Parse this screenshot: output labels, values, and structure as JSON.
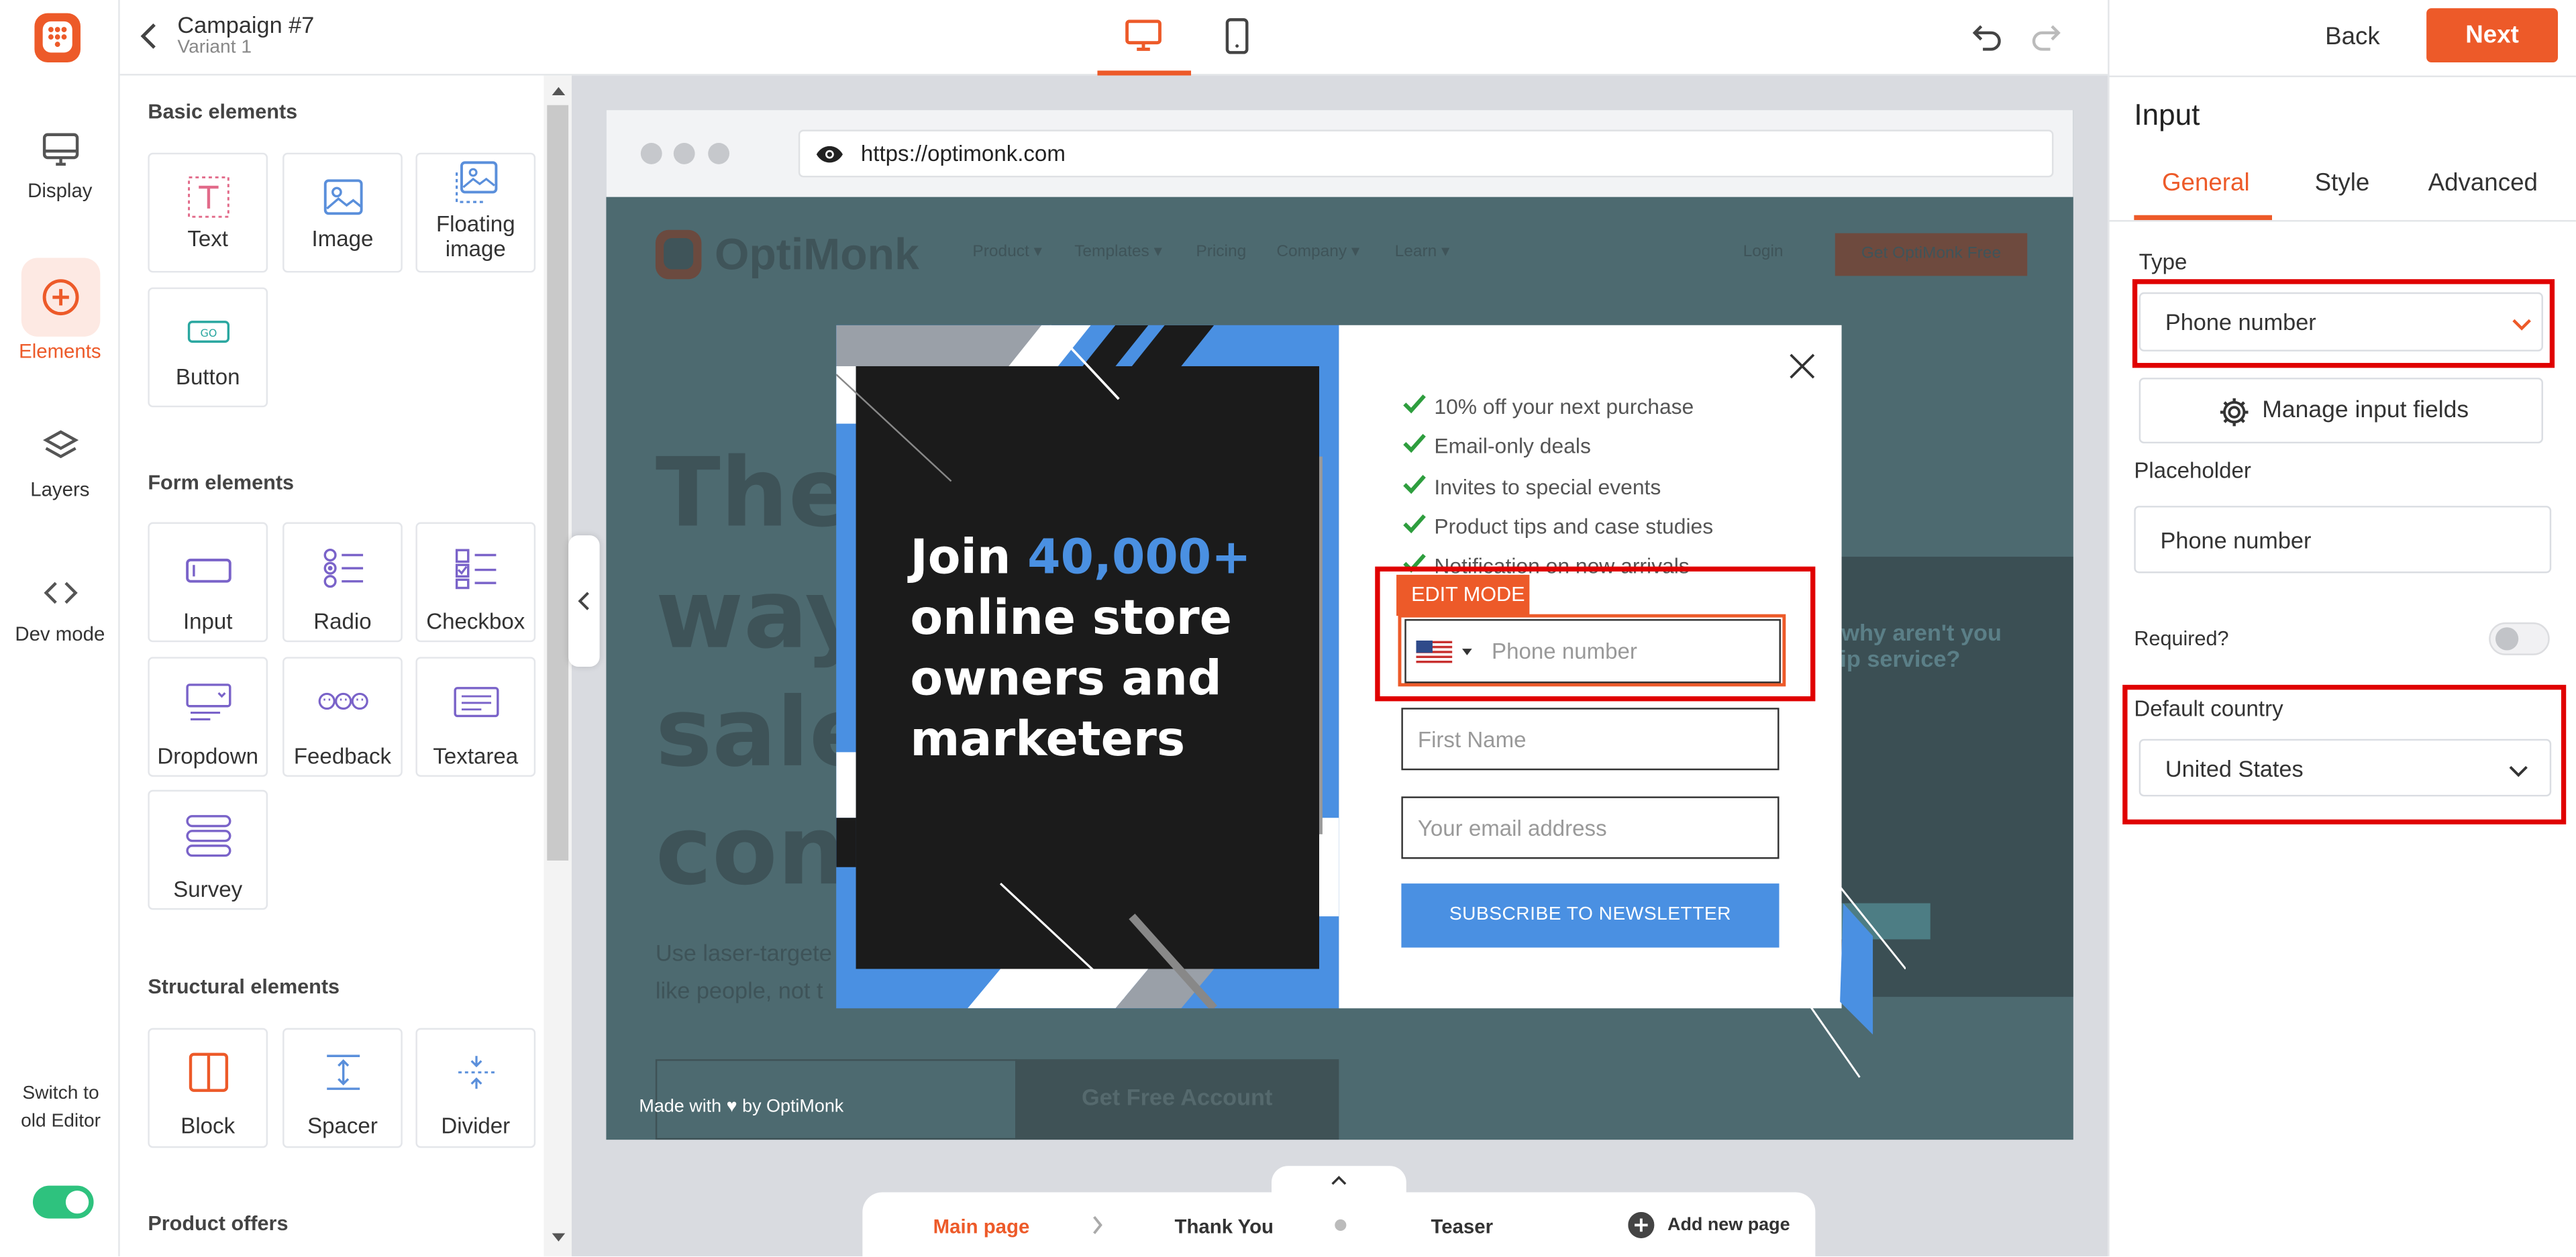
{
  "sidebar": {
    "items": [
      {
        "label": "Display",
        "icon": "monitor-icon"
      },
      {
        "label": "Elements",
        "icon": "plus-circle-icon"
      },
      {
        "label": "Layers",
        "icon": "layers-icon"
      },
      {
        "label": "Dev mode",
        "icon": "code-icon"
      }
    ],
    "switch_label": "Switch to old Editor"
  },
  "panel": {
    "basic_title": "Basic elements",
    "basic": [
      "Text",
      "Image",
      "Floating image",
      "Button"
    ],
    "form_title": "Form elements",
    "form": [
      "Input",
      "Radio",
      "Checkbox",
      "Dropdown",
      "Feedback",
      "Textarea",
      "Survey"
    ],
    "structural_title": "Structural elements",
    "structural": [
      "Block",
      "Spacer",
      "Divider"
    ],
    "product_title": "Product offers"
  },
  "header": {
    "campaign": "Campaign #7",
    "variant": "Variant 1",
    "back": "Back",
    "next": "Next"
  },
  "browser": {
    "url": "https://optimonk.com"
  },
  "site": {
    "logo": "OptiMonk",
    "nav": [
      "Product ▾",
      "Templates ▾",
      "Pricing",
      "Company ▾",
      "Learn ▾"
    ],
    "login": "Login",
    "cta": "Get OptiMonk Free",
    "hero_lines": [
      "The",
      "way",
      "sales",
      "conv"
    ],
    "hero_p1": "Use laser-targete",
    "hero_p2": "like people, not t",
    "side_text1": "are why aren't you",
    "side_text2": "e Flip service?",
    "free_btn": "Get Free Account",
    "made_with": "Made with ♥ by OptiMonk"
  },
  "popup": {
    "headline_join": "Join ",
    "headline_num": "40,000+",
    "headline_rest": [
      "online store",
      "owners and",
      "marketers"
    ],
    "benefits": [
      "10% off your next purchase",
      "Email-only deals",
      "Invites to special events",
      "Product tips and case studies",
      "Notification on new arrivals"
    ],
    "edit_mode": "EDIT MODE",
    "phone_placeholder": "Phone number",
    "first_name_placeholder": "First Name",
    "email_placeholder": "Your email address",
    "subscribe": "SUBSCRIBE TO NEWSLETTER"
  },
  "pages": {
    "main": "Main page",
    "thank_you": "Thank You",
    "teaser": "Teaser",
    "add": "Add new page"
  },
  "inspector": {
    "title": "Input",
    "tabs": [
      "General",
      "Style",
      "Advanced"
    ],
    "type_label": "Type",
    "type_value": "Phone number",
    "manage": "Manage input fields",
    "placeholder_label": "Placeholder",
    "placeholder_value": "Phone number",
    "required_label": "Required?",
    "country_label": "Default country",
    "country_value": "United States"
  },
  "colors": {
    "accent": "#ed5a29",
    "popup_blue": "#4a90e2",
    "toggle_green": "#2ec27e",
    "highlight_red": "#e00000"
  }
}
